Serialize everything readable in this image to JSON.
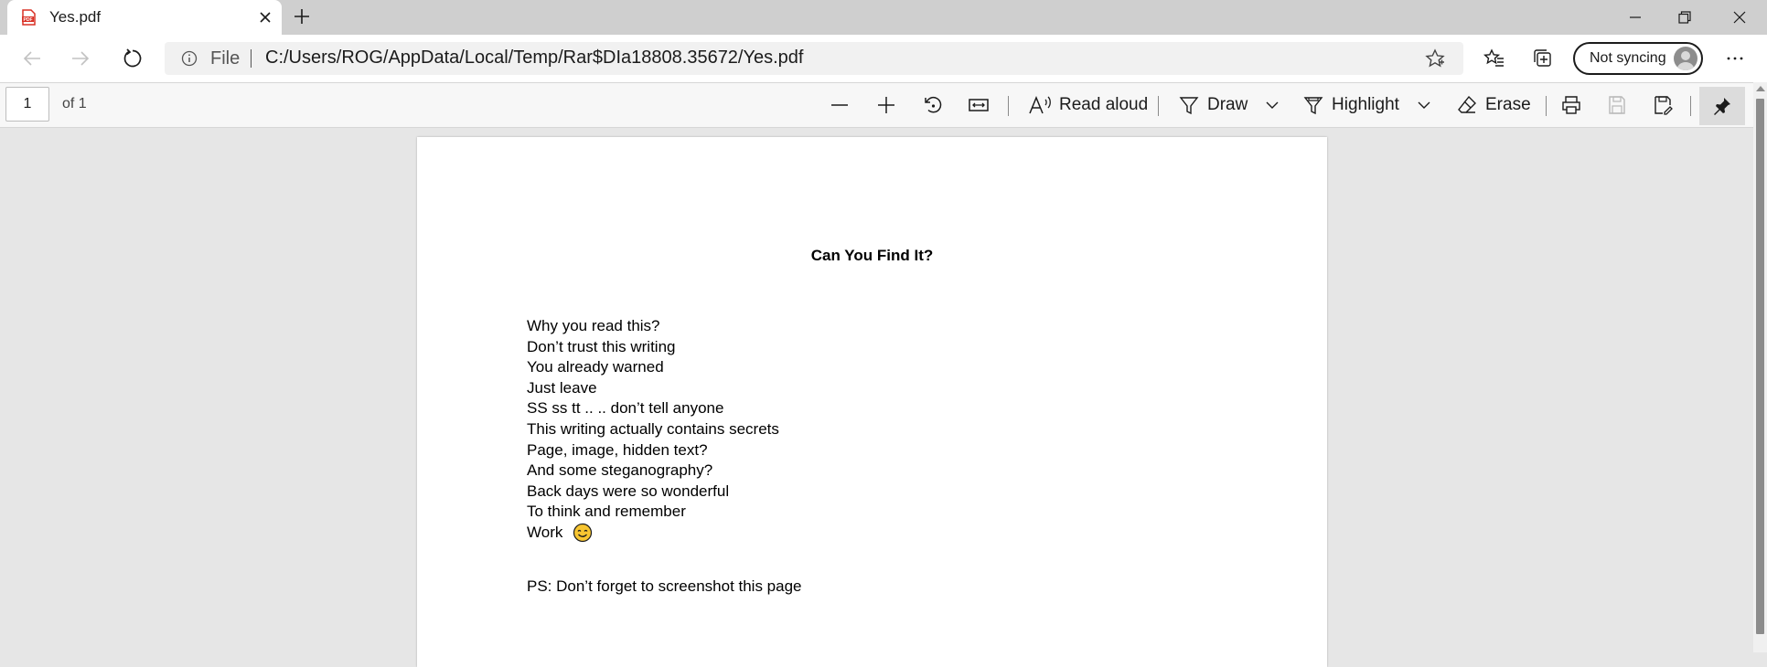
{
  "tab": {
    "title": "Yes.pdf",
    "favicon_text": "PDF"
  },
  "address_bar": {
    "scheme_label": "File",
    "url": "C:/Users/ROG/AppData/Local/Temp/Rar$DIa18808.35672/Yes.pdf"
  },
  "profile": {
    "label": "Not syncing"
  },
  "pdf_toolbar": {
    "page_number": "1",
    "page_total": "of 1",
    "read_aloud_label": "Read aloud",
    "draw_label": "Draw",
    "highlight_label": "Highlight",
    "erase_label": "Erase"
  },
  "document": {
    "title": "Can You Find It?",
    "lines": [
      "Why you read this?",
      "Don’t trust this writing",
      "You already warned",
      "Just leave",
      "SS ss tt .. .. don’t tell anyone",
      "This writing actually contains secrets",
      "Page, image, hidden text?",
      "And some steganography?",
      "Back days were so wonderful",
      "To think and remember",
      "Work"
    ],
    "ps": "PS: Don’t forget to screenshot this page"
  },
  "colors": {
    "tabstrip": "#cfcfcf",
    "viewer_bg": "#e6e6e6",
    "pdf_icon_red": "#d93025"
  }
}
